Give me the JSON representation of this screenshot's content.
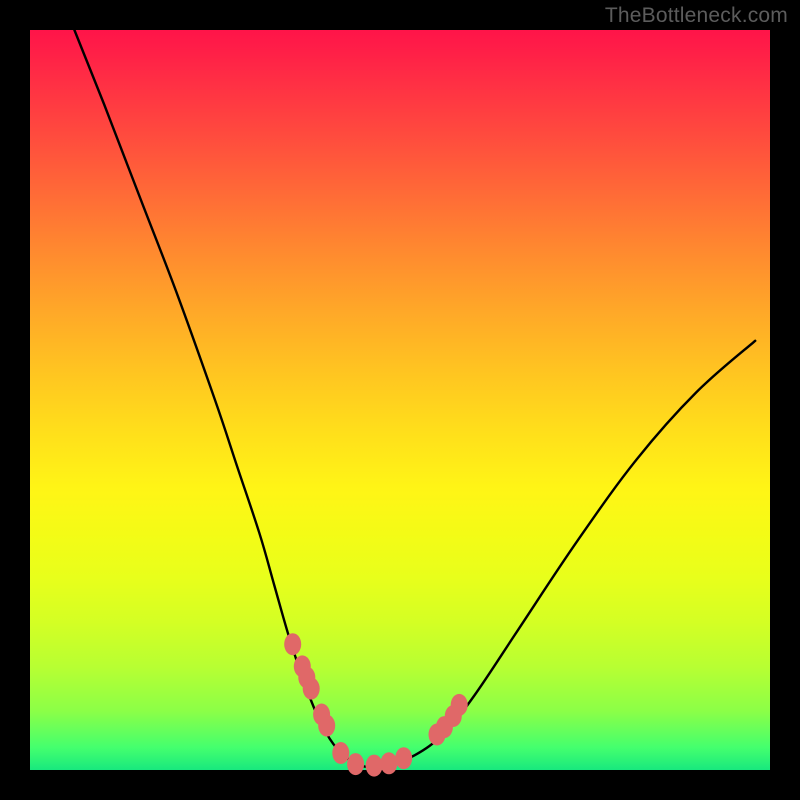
{
  "watermark": "TheBottleneck.com",
  "colors": {
    "frame": "#000000",
    "curve": "#000000",
    "marker_fill": "#e06868",
    "marker_stroke": "#c44f4f"
  },
  "chart_data": {
    "type": "line",
    "title": "",
    "xlabel": "",
    "ylabel": "",
    "xlim": [
      0,
      100
    ],
    "ylim": [
      0,
      100
    ],
    "grid": false,
    "legend": false,
    "series": [
      {
        "name": "bottleneck-curve",
        "x": [
          6,
          10,
          15,
          20,
          25,
          28,
          31,
          33,
          35,
          37,
          39,
          41,
          43,
          45,
          48,
          52,
          56,
          60,
          66,
          74,
          82,
          90,
          98
        ],
        "y": [
          100,
          90,
          77,
          64,
          50,
          41,
          32,
          25,
          18,
          12,
          7,
          3.5,
          1.5,
          0.5,
          0.6,
          2,
          5,
          10,
          19,
          31,
          42,
          51,
          58
        ]
      }
    ],
    "markers": {
      "name": "highlighted-points",
      "x": [
        35.5,
        36.8,
        37.4,
        38.0,
        39.4,
        40.1,
        42.0,
        44.0,
        46.5,
        48.5,
        50.5,
        55.0,
        56.0,
        57.2,
        58.0
      ],
      "y": [
        17.0,
        14.0,
        12.5,
        11.0,
        7.5,
        6.0,
        2.3,
        0.8,
        0.6,
        0.9,
        1.6,
        4.8,
        5.8,
        7.3,
        8.8
      ]
    }
  }
}
